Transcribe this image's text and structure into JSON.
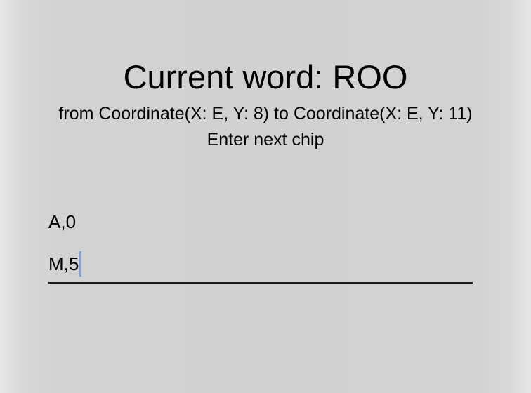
{
  "header": {
    "title": "Current word: ROO",
    "subtitle": "from Coordinate(X: E, Y: 8) to Coordinate(X: E, Y: 11)",
    "prompt": "Enter next chip"
  },
  "entries": [
    {
      "text": "A,0"
    }
  ],
  "input": {
    "value": "M,5"
  },
  "colors": {
    "background": "#d1d1d1",
    "text": "#000000",
    "caret": "#7fa3d8",
    "underline": "#1a1a1a"
  }
}
